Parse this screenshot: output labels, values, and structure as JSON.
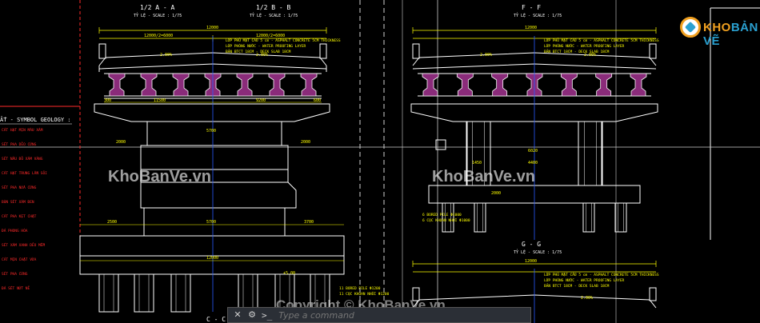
{
  "section_titles": {
    "aa": "1/2 A - A",
    "bb": "1/2 B - B",
    "ff": "F - F",
    "gg": "G - G",
    "cc": "C - C",
    "scale": "TỶ LỆ - SCALE : 1/75"
  },
  "dims_top": {
    "aa_total": "12000",
    "aa_half": "12000/2=6000",
    "bb_half": "12000/2=6000",
    "ff_total": "12000",
    "gg_total": "12000"
  },
  "layers_note": [
    "LỚP PHỦ MẶT CẦU 5 cm - ASPHALT CONCRETE 5CM THICKNESS",
    "LỚP PHÒNG NƯỚC - WATER PROOFING LAYER",
    "BẢN BTCT 18CM - DECK SLAB 18CM"
  ],
  "slope_label": "2.00%",
  "deck_dims": [
    "11500",
    "9200",
    "300",
    "600"
  ],
  "pier_dims": [
    "2000",
    "5700",
    "2000",
    "12000",
    "1000",
    "2500",
    "3700"
  ],
  "ff_dims": [
    "6020",
    "2000",
    "4400",
    "1450"
  ],
  "pile_note_1": "11 BORED PILE Φ1200",
  "pile_note_2": "11 CỌC KHOAN NHỒI Φ1200",
  "pile_note_ff_1": "6 BORED PILE Φ1000",
  "pile_note_ff_2": "6 CỌC KHOAN NHỒI Φ1000",
  "legend_title": "ẤT - SYMBOL GEOLOGY :",
  "legend_lines": [
    "CÁT HẠT MỊN MÀU XÁM",
    "SÉT PHA DẺO CỨNG",
    "SÉT NÂU ĐỎ XÁM VÀNG",
    "CÁT HẠT TRUNG LẪN SỎI",
    "SÉT PHA NỬA CỨNG",
    "BÙN SÉT XÁM ĐEN",
    "CÁT PHA KẸT CHẶT",
    "ĐÁ PHONG HÓA",
    "SÉT XÁM XANH DẺO MỀM",
    "CÁT MỊN CHẶT VỪA",
    "SÉT PHA CỨNG",
    "ĐÁ SÉT NỨT NẺ"
  ],
  "level_mark": "+5.00",
  "logo": {
    "part1": "KHO",
    "part2": "BẢN VẼ"
  },
  "watermark": "KhoBanVe.vn",
  "copyright": "Copyright © KhoBanVe.vn",
  "command": {
    "prompt": ">_",
    "placeholder": "Type a command"
  },
  "colors": {
    "background": "#000000",
    "line": "#ffffff",
    "text": "#ffff00",
    "legend": "#ff2a2a",
    "accent": "#c000ff",
    "axis": "#2a5cff"
  }
}
